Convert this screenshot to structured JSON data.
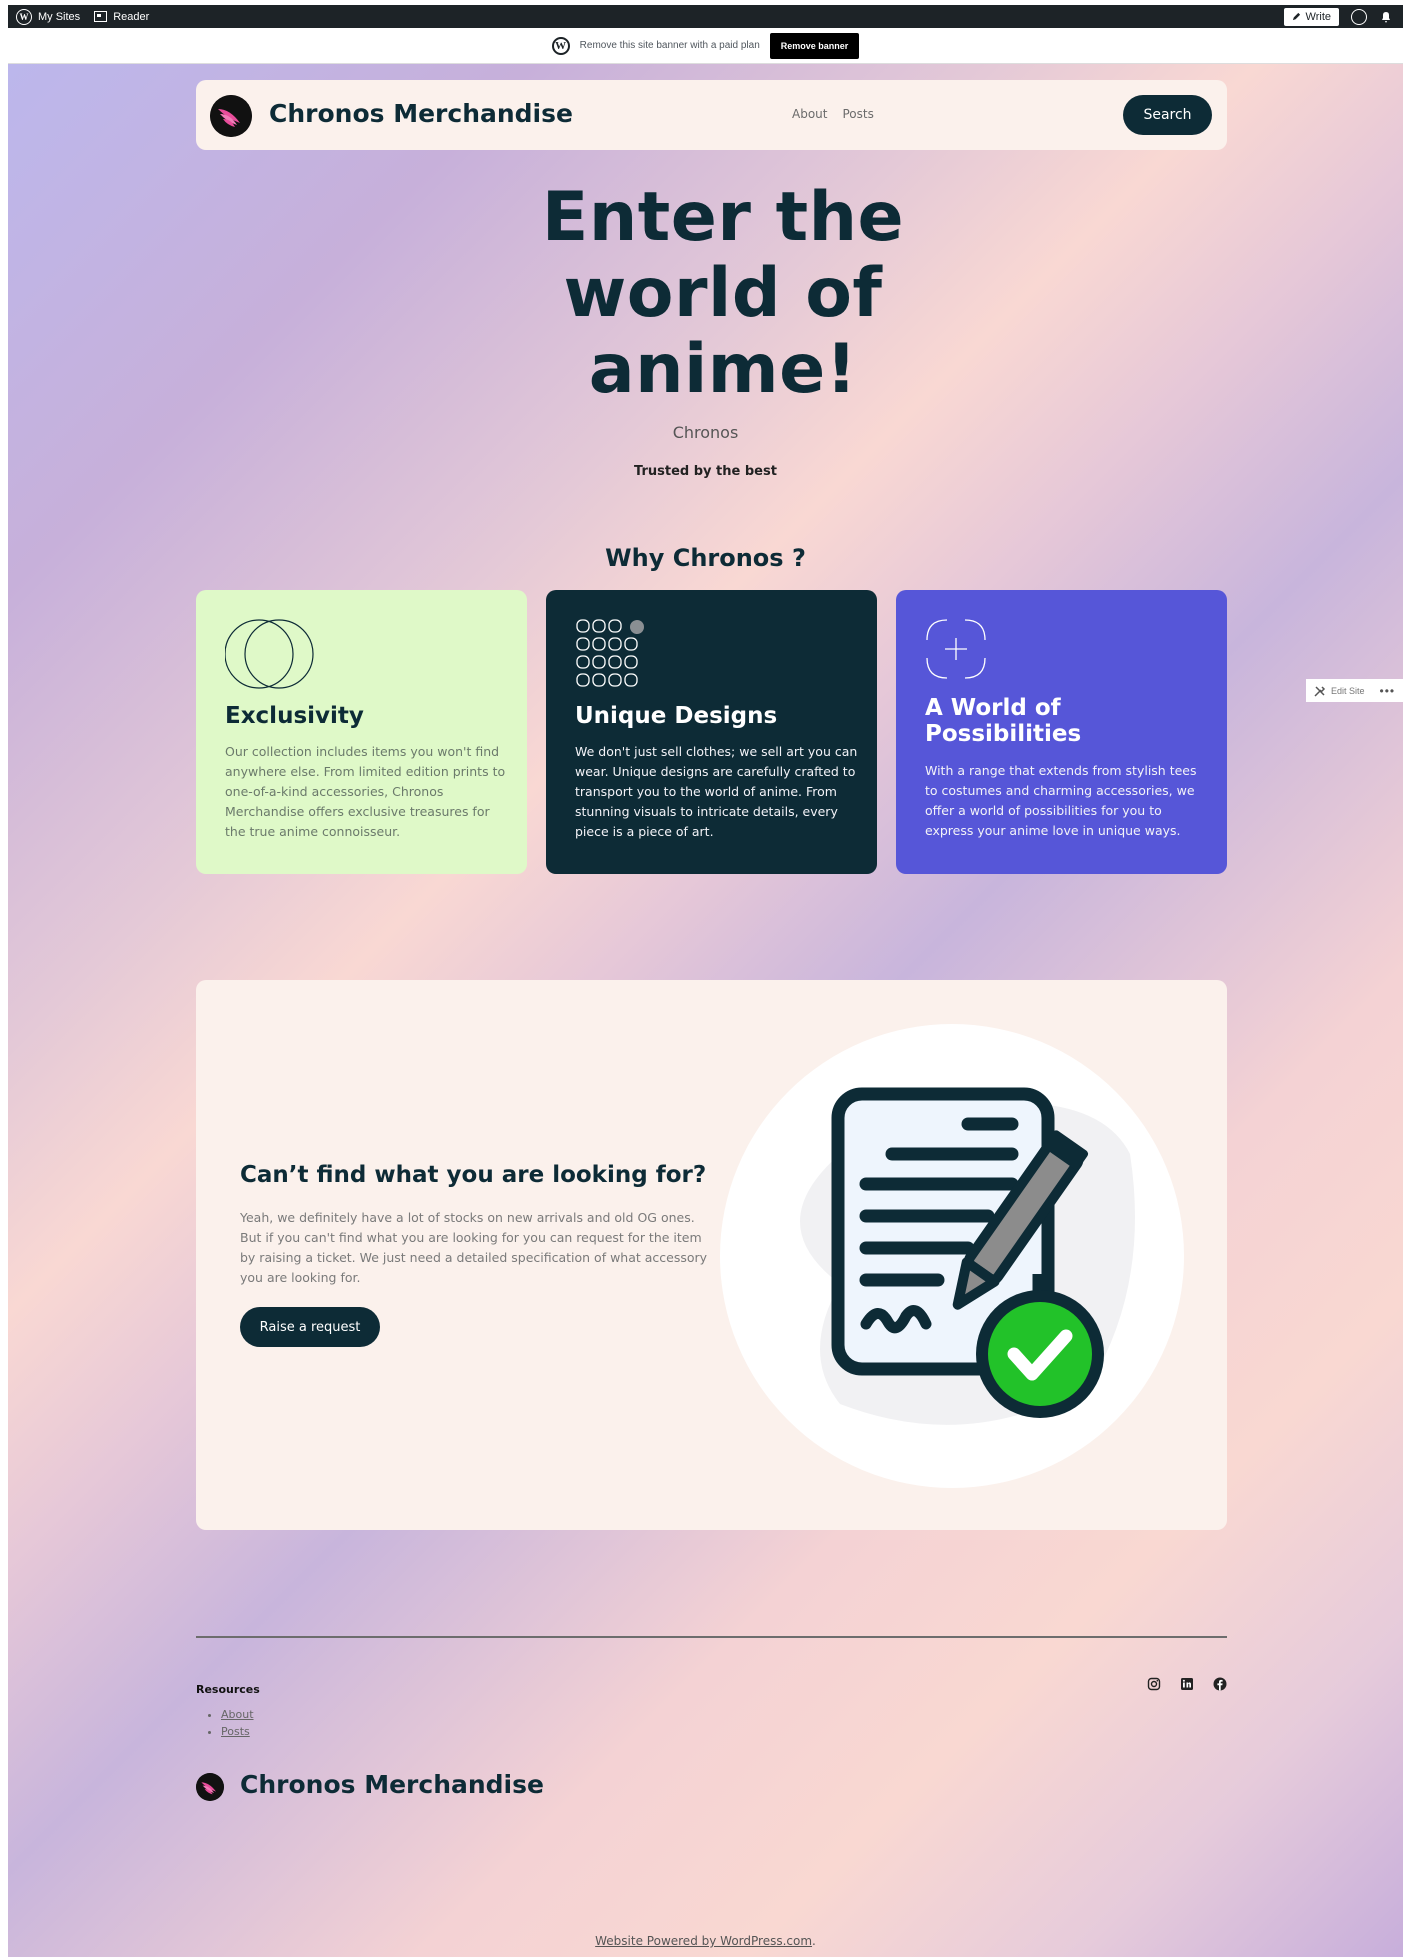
{
  "adminbar": {
    "my_sites": "My Sites",
    "reader": "Reader",
    "write": "Write"
  },
  "banner": {
    "message": "Remove this site banner with a paid plan",
    "button": "Remove banner"
  },
  "header": {
    "site_title": "Chronos Merchandise",
    "nav": [
      "About",
      "Posts"
    ],
    "search": "Search"
  },
  "hero": {
    "title_lines": [
      "Enter the",
      "world of",
      "anime!"
    ],
    "subtitle": "Chronos",
    "trust": "Trusted by the best"
  },
  "why": {
    "title": "Why Chronos ?",
    "cards": [
      {
        "icon": "overlapping-circles-icon",
        "title": "Exclusivity",
        "text": "Our collection includes items you won't find anywhere else. From limited edition prints to one-of-a-kind accessories, Chronos Merchandise offers exclusive treasures for the true anime connoisseur.",
        "bg": "#dff9c8"
      },
      {
        "icon": "dot-grid-icon",
        "title": "Unique Designs",
        "text": "We don't just sell clothes; we sell art you can wear. Unique designs are carefully crafted to transport you to the world of anime. From stunning visuals to intricate details, every piece is a piece of art.",
        "bg": "#0d2b36"
      },
      {
        "icon": "focus-plus-icon",
        "title_lines": [
          "A World of",
          "Possibilities"
        ],
        "text": "With a range that extends from stylish tees to costumes and charming accessories, we offer a world of possibilities for you to express your anime love in unique ways.",
        "bg": "#5656d8"
      }
    ]
  },
  "request": {
    "title": "Can’t find what you are looking for?",
    "text": "Yeah, we definitely have a lot of stocks on new arrivals and old OG ones. But if you can't find what you are looking for you can request for the item by raising a ticket. We just need a detailed specification of what accessory you are looking for.",
    "button": "Raise a request",
    "illustration": "document-signed-check-icon"
  },
  "footer": {
    "resources_heading": "Resources",
    "links": [
      "About",
      "Posts"
    ],
    "social": [
      "instagram-icon",
      "linkedin-icon",
      "facebook-icon"
    ],
    "site_title": "Chronos Merchandise",
    "powered": "Website Powered by WordPress.com",
    "powered_suffix": "."
  },
  "edit_site": {
    "label": "Edit Site",
    "more": "•••"
  },
  "colors": {
    "primary": "#0d2b36",
    "header_bg": "#fbf1ec",
    "accent_green": "#22c229",
    "purple": "#5656d8",
    "lime": "#dff9c8"
  }
}
